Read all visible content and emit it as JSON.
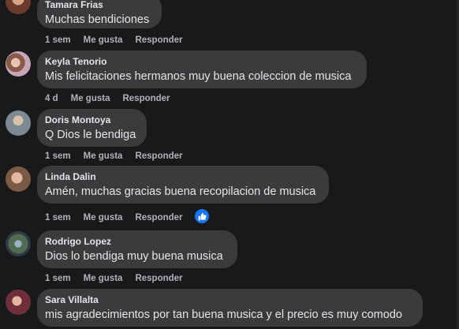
{
  "comments": [
    {
      "name": "Tamara Frias",
      "text": "Muchas bendiciones",
      "time": "1 sem",
      "like": "Me gusta",
      "reply": "Responder"
    },
    {
      "name": "Keyla Tenorio",
      "text": "Mis felicitaciones hermanos muy buena coleccion de musica",
      "time": "4 d",
      "like": "Me gusta",
      "reply": "Responder"
    },
    {
      "name": "Doris Montoya",
      "text": "Q Dios le bendiga",
      "time": "1 sem",
      "like": "Me gusta",
      "reply": "Responder"
    },
    {
      "name": "Linda Dalin",
      "text": "Amén, muchas gracias buena recopilacion de musica",
      "time": "1 sem",
      "like": "Me gusta",
      "reply": "Responder",
      "reaction": "like-icon"
    },
    {
      "name": "Rodrigo Lopez",
      "text": "Dios lo bendiga muy buena musica",
      "time": "1 sem",
      "like": "Me gusta",
      "reply": "Responder"
    },
    {
      "name": "Sara Villalta",
      "text": "mis agradecimientos por tan buena musica y el precio es muy comodo",
      "time": "",
      "like": "",
      "reply": ""
    }
  ],
  "colors": {
    "background": "#18191a",
    "bubble": "#3a3b3c",
    "text": "#e4e6eb",
    "secondary_text": "#b0b3b8",
    "like_blue": "#1877f2"
  }
}
